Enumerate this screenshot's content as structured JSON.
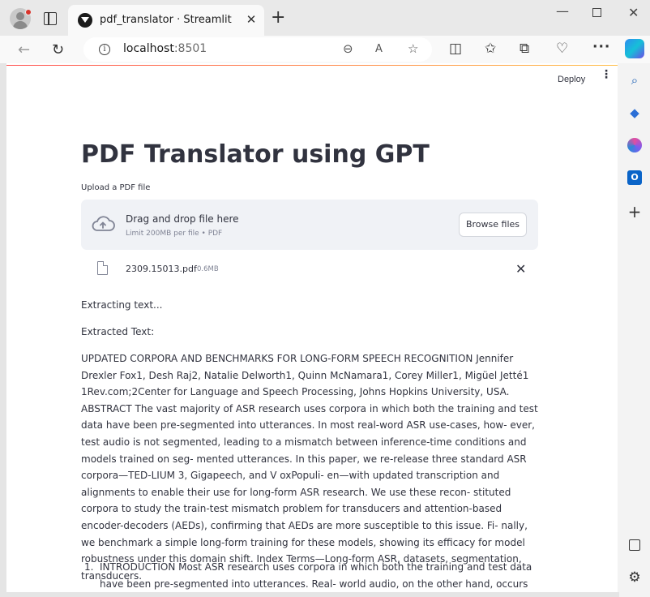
{
  "browser": {
    "tab_title": "pdf_translator · Streamlit",
    "tab_close": "✕",
    "new_tab": "+",
    "url_host": "localhost",
    "url_port": ":8501",
    "window_controls": {
      "minimize": "—",
      "close": "✕"
    },
    "icons": [
      "profile-icon",
      "tab-actions-icon",
      "back-icon",
      "reload-icon",
      "info-icon",
      "zoom-icon",
      "read-aloud-icon",
      "favorite-star-icon",
      "split-screen-icon",
      "favorites-icon",
      "collections-icon",
      "health-icon",
      "more-icon",
      "copilot-icon"
    ]
  },
  "streamlit": {
    "deploy_label": "Deploy",
    "menu_icon": "⋮"
  },
  "app": {
    "title": "PDF Translator using GPT",
    "uploader": {
      "label": "Upload a PDF file",
      "drop_text": "Drag and drop file here",
      "limit_text": "Limit 200MB per file • PDF",
      "browse_label": "Browse files"
    },
    "file": {
      "name": "2309.15013.pdf",
      "size": "0.6MB",
      "remove": "✕"
    },
    "status_extracting": "Extracting text...",
    "extracted_heading": "Extracted Text:",
    "extracted_body": "UPDATED CORPORA AND BENCHMARKS FOR LONG-FORM SPEECH RECOGNITION Jennifer Drexler Fox1, Desh Raj2, Natalie Delworth1, Quinn McNamara1, Corey Miller1, Migüel Jetté1 1Rev.com;2Center for Language and Speech Processing, Johns Hopkins University, USA. ABSTRACT The vast majority of ASR research uses corpora in which both the training and test data have been pre-segmented into utterances. In most real-word ASR use-cases, how- ever, test audio is not segmented, leading to a mismatch between inference-time conditions and models trained on seg- mented utterances. In this paper, we re-release three standard ASR corpora—TED-LIUM 3, Gigapeech, and V oxPopuli- en—with updated transcription and alignments to enable their use for long-form ASR research. We use these recon- stituted corpora to study the train-test mismatch problem for transducers and attention-based encoder-decoders (AEDs), confirming that AEDs are more susceptible to this issue. Fi- nally, we benchmark a simple long-form training for these models, showing its efficacy for model robustness under this domain shift. Index Terms—Long-form ASR, datasets, segmentation, transducers.",
    "list_item_number": "1.",
    "list_item_text": "INTRODUCTION Most ASR research uses corpora in which both the training and test data have been pre-segmented into utterances. Real- world audio, on the other hand, occurs as long-form unseg-"
  },
  "edge_sidebar": {
    "icons": [
      "search-icon",
      "shopping-tag-icon",
      "microsoft365-icon",
      "outlook-icon",
      "add-icon",
      "sidebar-layout-icon",
      "settings-icon"
    ],
    "outlook_letter": "O"
  },
  "colors": {
    "accent_red": "#ff4b4b",
    "accent_yellow": "#ffbd45",
    "text": "#31333f",
    "muted": "#808495",
    "dropzone_bg": "#f0f2f6"
  }
}
